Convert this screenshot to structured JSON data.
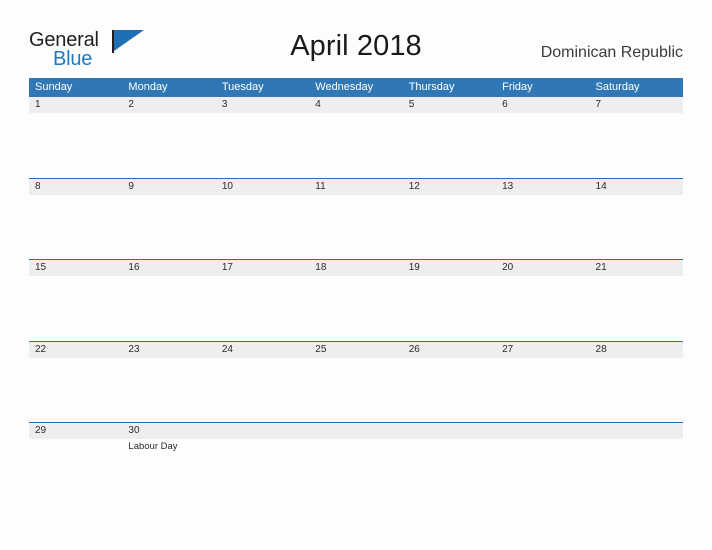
{
  "brand": {
    "name_top": "General",
    "name_bottom": "Blue",
    "flag_icon": "triangle-flag-icon",
    "color_primary": "#1f6fb5",
    "color_text": "#231f20"
  },
  "header": {
    "title": "April 2018",
    "country": "Dominican Republic"
  },
  "calendar": {
    "header_bg": "#3077b5",
    "band_bg": "#eeeeee",
    "rule_color": "#2b6eb0",
    "weekdays": [
      "Sunday",
      "Monday",
      "Tuesday",
      "Wednesday",
      "Thursday",
      "Friday",
      "Saturday"
    ],
    "weeks": [
      [
        {
          "day": "1",
          "event": ""
        },
        {
          "day": "2",
          "event": ""
        },
        {
          "day": "3",
          "event": ""
        },
        {
          "day": "4",
          "event": ""
        },
        {
          "day": "5",
          "event": ""
        },
        {
          "day": "6",
          "event": ""
        },
        {
          "day": "7",
          "event": ""
        }
      ],
      [
        {
          "day": "8",
          "event": ""
        },
        {
          "day": "9",
          "event": ""
        },
        {
          "day": "10",
          "event": ""
        },
        {
          "day": "11",
          "event": ""
        },
        {
          "day": "12",
          "event": ""
        },
        {
          "day": "13",
          "event": ""
        },
        {
          "day": "14",
          "event": ""
        }
      ],
      [
        {
          "day": "15",
          "event": ""
        },
        {
          "day": "16",
          "event": ""
        },
        {
          "day": "17",
          "event": ""
        },
        {
          "day": "18",
          "event": ""
        },
        {
          "day": "19",
          "event": ""
        },
        {
          "day": "20",
          "event": ""
        },
        {
          "day": "21",
          "event": ""
        }
      ],
      [
        {
          "day": "22",
          "event": ""
        },
        {
          "day": "23",
          "event": ""
        },
        {
          "day": "24",
          "event": ""
        },
        {
          "day": "25",
          "event": ""
        },
        {
          "day": "26",
          "event": ""
        },
        {
          "day": "27",
          "event": ""
        },
        {
          "day": "28",
          "event": ""
        }
      ],
      [
        {
          "day": "29",
          "event": ""
        },
        {
          "day": "30",
          "event": "Labour Day"
        },
        {
          "day": "",
          "event": ""
        },
        {
          "day": "",
          "event": ""
        },
        {
          "day": "",
          "event": ""
        },
        {
          "day": "",
          "event": ""
        },
        {
          "day": "",
          "event": ""
        }
      ]
    ]
  }
}
